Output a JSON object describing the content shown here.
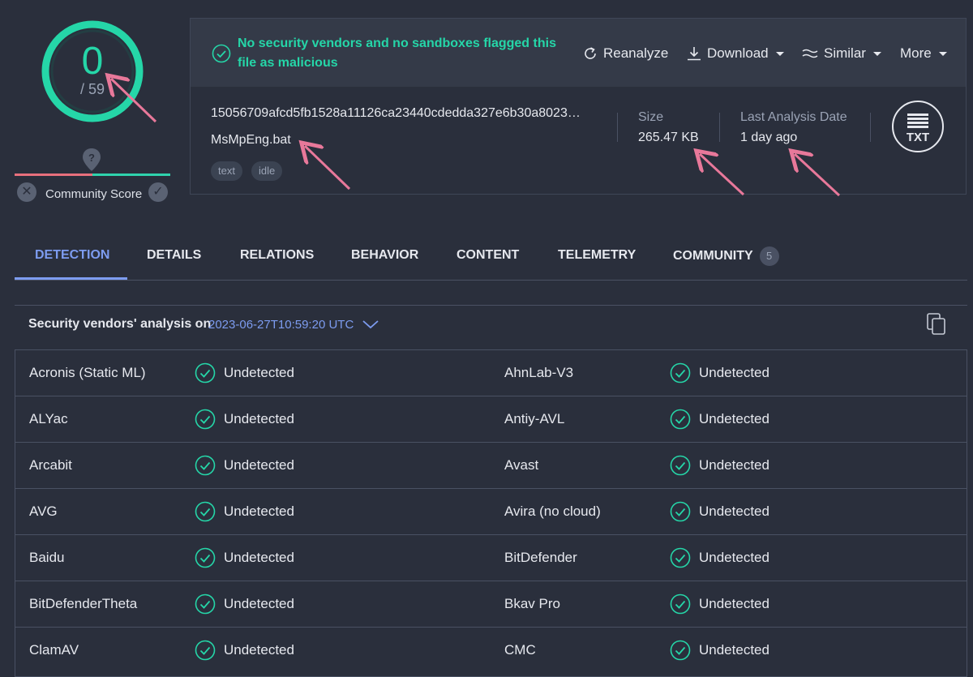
{
  "score": {
    "detections": "0",
    "total": "/ 59"
  },
  "community": {
    "label": "Community Score"
  },
  "summary": {
    "message": "No security vendors and no sandboxes flagged this file as malicious",
    "actions": {
      "reanalyze": "Reanalyze",
      "download": "Download",
      "similar": "Similar",
      "more": "More"
    }
  },
  "file": {
    "hash": "15056709afcd5fb1528a11126ca23440cdedda327e6b30a8023…",
    "name": "MsMpEng.bat",
    "tags": [
      "text",
      "idle"
    ],
    "size_label": "Size",
    "size": "265.47 KB",
    "date_label": "Last Analysis Date",
    "date": "1 day ago",
    "type_badge": "TXT"
  },
  "tabs": [
    {
      "label": "DETECTION",
      "active": true
    },
    {
      "label": "DETAILS"
    },
    {
      "label": "RELATIONS"
    },
    {
      "label": "BEHAVIOR"
    },
    {
      "label": "CONTENT"
    },
    {
      "label": "TELEMETRY"
    },
    {
      "label": "COMMUNITY",
      "count": "5"
    }
  ],
  "analysis": {
    "title": "Security vendors' analysis on",
    "date": "2023-06-27T10:59:20 UTC"
  },
  "vendors": [
    {
      "left": "Acronis (Static ML)",
      "left_status": "Undetected",
      "right": "AhnLab-V3",
      "right_status": "Undetected"
    },
    {
      "left": "ALYac",
      "left_status": "Undetected",
      "right": "Antiy-AVL",
      "right_status": "Undetected"
    },
    {
      "left": "Arcabit",
      "left_status": "Undetected",
      "right": "Avast",
      "right_status": "Undetected"
    },
    {
      "left": "AVG",
      "left_status": "Undetected",
      "right": "Avira (no cloud)",
      "right_status": "Undetected"
    },
    {
      "left": "Baidu",
      "left_status": "Undetected",
      "right": "BitDefender",
      "right_status": "Undetected"
    },
    {
      "left": "BitDefenderTheta",
      "left_status": "Undetected",
      "right": "Bkav Pro",
      "right_status": "Undetected"
    },
    {
      "left": "ClamAV",
      "left_status": "Undetected",
      "right": "CMC",
      "right_status": "Undetected"
    }
  ],
  "colors": {
    "accent_green": "#25d6a8",
    "accent_blue": "#7d9cf0",
    "background": "#2a2f3c",
    "arrow_pink": "#e8789a"
  }
}
